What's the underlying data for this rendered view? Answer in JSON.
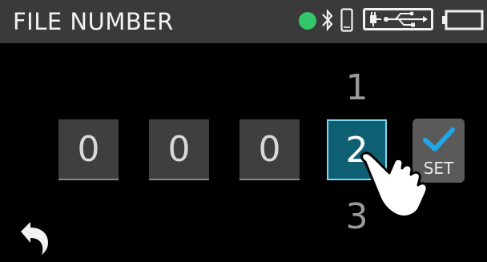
{
  "header": {
    "title": "FILE NUMBER",
    "status_icons": [
      "record-dot-icon",
      "bluetooth-icon",
      "phone-icon",
      "usb-icon",
      "battery-icon"
    ],
    "dot_color": "#33c66a"
  },
  "picker": {
    "digits": [
      "0",
      "0",
      "0",
      "2"
    ],
    "active_index": 3,
    "above_value": "1",
    "below_value": "3",
    "accent": "#0f5f73"
  },
  "set_button": {
    "label": "SET",
    "icon": "check-icon",
    "check_color": "#1ea6e8"
  },
  "back_button": {
    "icon": "back-arrow-icon"
  },
  "overlay": {
    "icon": "pointing-hand-icon"
  }
}
